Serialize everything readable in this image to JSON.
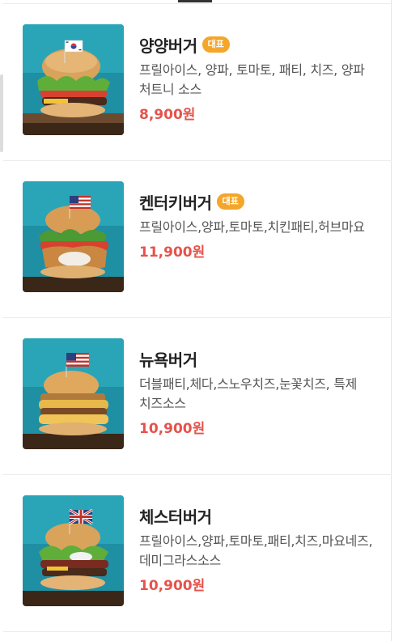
{
  "menu": {
    "items": [
      {
        "name": "양양버거",
        "badge": "대표",
        "description": "프릴아이스, 양파, 토마토, 패티, 치즈, 양파 처트니 소스",
        "price": "8,900원",
        "flag": "korea-flag",
        "image": "burger-photo"
      },
      {
        "name": "켄터키버거",
        "badge": "대표",
        "description": "프릴아이스,양파,토마토,치킨패티,허브마요",
        "price": "11,900원",
        "flag": "usa-flag",
        "image": "chicken-burger-photo"
      },
      {
        "name": "뉴욕버거",
        "badge": "",
        "description": "더블패티,체다,스노우치즈,눈꽃치즈, 특제 치즈소스",
        "price": "10,900원",
        "flag": "usa-flag",
        "image": "cheese-burger-photo"
      },
      {
        "name": "체스터버거",
        "badge": "",
        "description": "프릴아이스,양파,토마토,패티,치즈,마요네즈,데미그라스소스",
        "price": "10,900원",
        "flag": "uk-flag",
        "image": "burger-photo"
      }
    ]
  },
  "colors": {
    "price": "#e5534b",
    "badge": "#f4a62a",
    "photo_background": "#1f8fa3"
  }
}
